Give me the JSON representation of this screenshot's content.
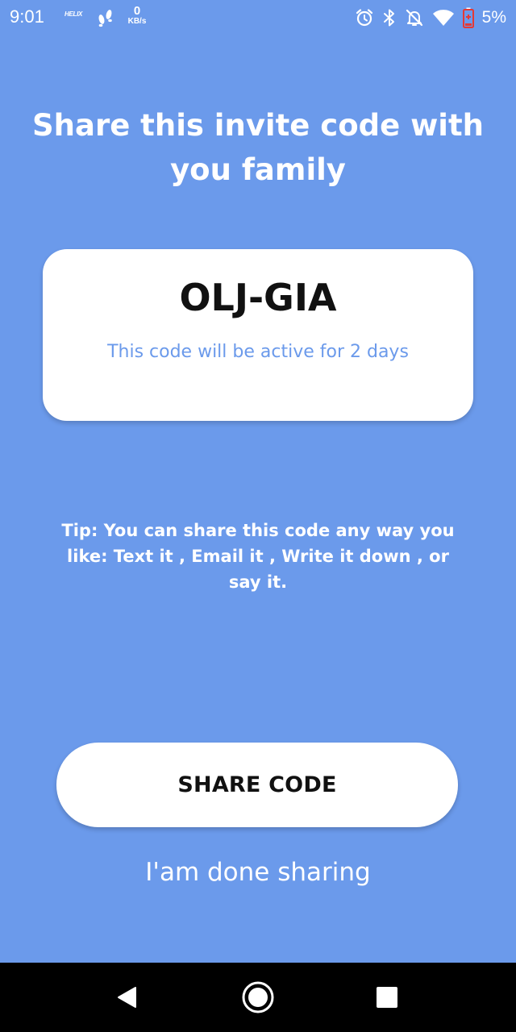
{
  "status_bar": {
    "time": "9:01",
    "carrier_logo": "HELIX",
    "network_speed_value": "0",
    "network_speed_unit": "KB/s",
    "battery_percent": "5%",
    "icons": [
      "walk-icon",
      "alarm-icon",
      "bluetooth-icon",
      "notifications-off-icon",
      "wifi-icon",
      "battery-icon"
    ]
  },
  "main": {
    "title": "Share this invite code with you family",
    "code": "OLJ-GIA",
    "code_note": "This code will be active for 2 days",
    "tip": "Tip: You can share this code any way you like: Text it , Email it , Write it down , or say it.",
    "share_button_label": "SHARE CODE",
    "done_link_label": "I'am done sharing"
  },
  "nav_bar": {
    "icons": [
      "back-icon",
      "home-icon",
      "recents-icon"
    ]
  },
  "colors": {
    "background": "#6b9aeb",
    "card": "#ffffff",
    "accent_text": "#6b9aeb",
    "battery_low": "#e53935"
  }
}
